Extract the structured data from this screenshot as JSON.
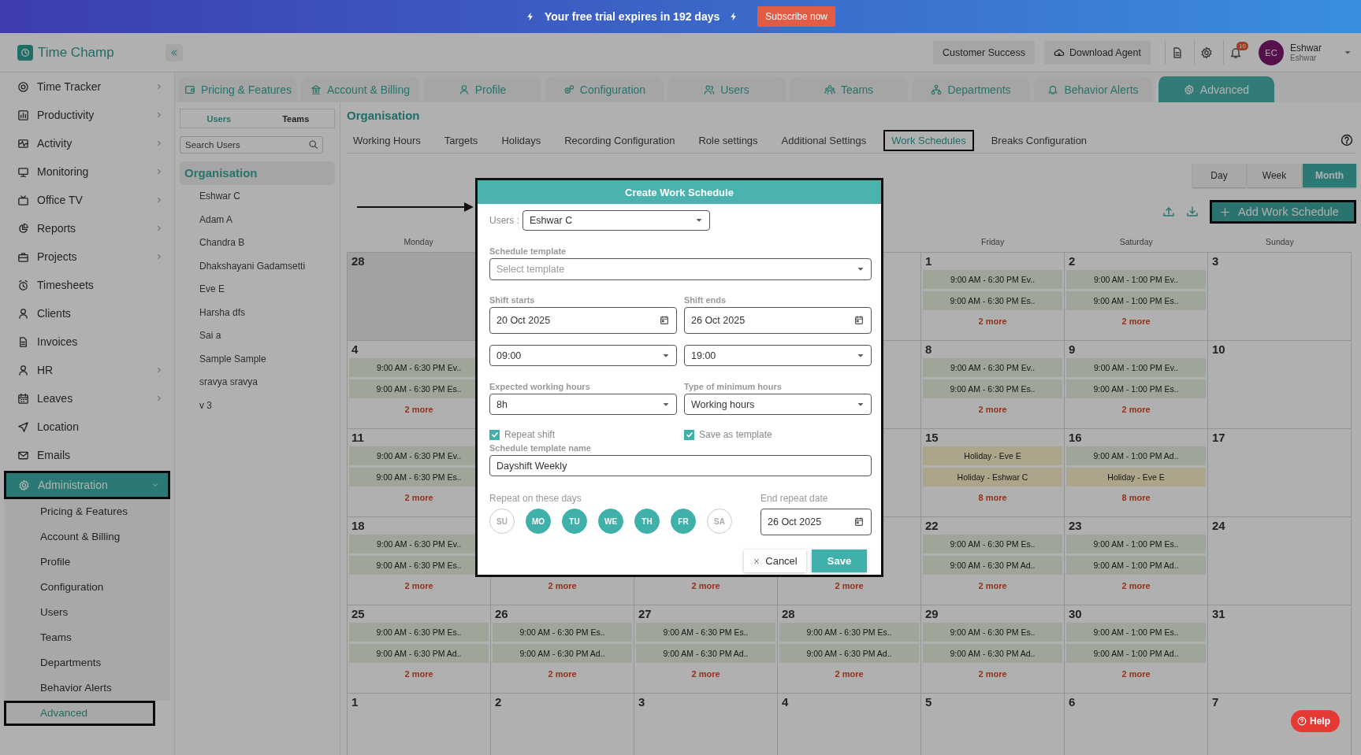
{
  "banner": {
    "message": "Your free trial expires in 192 days",
    "action": "Subscribe now"
  },
  "header": {
    "app_name": "Time Champ",
    "buttons": [
      "Customer Success",
      "Download Agent"
    ],
    "notification_count": "10",
    "user": {
      "initials": "EC",
      "name": "Eshwar",
      "subtitle": "Eshwar"
    }
  },
  "sidebar": {
    "items": [
      {
        "label": "Time Tracker",
        "has_submenu": true,
        "expanded": false,
        "selected": false
      },
      {
        "label": "Productivity",
        "has_submenu": true,
        "expanded": false,
        "selected": false
      },
      {
        "label": "Activity",
        "has_submenu": true,
        "expanded": false,
        "selected": false
      },
      {
        "label": "Monitoring",
        "has_submenu": true,
        "expanded": false,
        "selected": false
      },
      {
        "label": "Office TV",
        "has_submenu": true,
        "expanded": false,
        "selected": false
      },
      {
        "label": "Reports",
        "has_submenu": true,
        "expanded": false,
        "selected": false
      },
      {
        "label": "Projects",
        "has_submenu": true,
        "expanded": false,
        "selected": false
      },
      {
        "label": "Timesheets",
        "has_submenu": false,
        "selected": false
      },
      {
        "label": "Clients",
        "has_submenu": false,
        "selected": false
      },
      {
        "label": "Invoices",
        "has_submenu": false,
        "selected": false
      },
      {
        "label": "HR",
        "has_submenu": true,
        "expanded": false,
        "selected": false
      },
      {
        "label": "Leaves",
        "has_submenu": true,
        "expanded": false,
        "selected": false
      },
      {
        "label": "Location",
        "has_submenu": false,
        "selected": false
      },
      {
        "label": "Emails",
        "has_submenu": false,
        "selected": false
      },
      {
        "label": "Administration",
        "has_submenu": true,
        "expanded": true,
        "selected": true,
        "children": [
          {
            "label": "Pricing & Features",
            "selected": false
          },
          {
            "label": "Account & Billing",
            "selected": false
          },
          {
            "label": "Profile",
            "selected": false
          },
          {
            "label": "Configuration",
            "selected": false
          },
          {
            "label": "Users",
            "selected": false
          },
          {
            "label": "Teams",
            "selected": false
          },
          {
            "label": "Departments",
            "selected": false
          },
          {
            "label": "Behavior Alerts",
            "selected": false
          },
          {
            "label": "Advanced",
            "selected": true
          }
        ]
      }
    ]
  },
  "admin_tabs": [
    {
      "label": "Pricing & Features",
      "selected": false
    },
    {
      "label": "Account & Billing",
      "selected": false
    },
    {
      "label": "Profile",
      "selected": false
    },
    {
      "label": "Configuration",
      "selected": false
    },
    {
      "label": "Users",
      "selected": false
    },
    {
      "label": "Teams",
      "selected": false
    },
    {
      "label": "Departments",
      "selected": false
    },
    {
      "label": "Behavior Alerts",
      "selected": false
    },
    {
      "label": "Advanced",
      "selected": true
    }
  ],
  "user_panel": {
    "toggle": [
      {
        "label": "Users",
        "selected": true
      },
      {
        "label": "Teams",
        "selected": false
      }
    ],
    "search": {
      "placeholder": "Search Users"
    },
    "group": "Organisation",
    "users": [
      "Eshwar C",
      "Adam A",
      "Chandra B",
      "Dhakshayani Gadamsetti",
      "Eve E",
      "Harsha dfs",
      "Sai a",
      "Sample Sample",
      "sravya sravya",
      "v 3"
    ]
  },
  "main": {
    "title": "Organisation",
    "subtabs": [
      {
        "label": "Working Hours",
        "selected": false
      },
      {
        "label": "Targets",
        "selected": false
      },
      {
        "label": "Holidays",
        "selected": false
      },
      {
        "label": "Recording Configuration",
        "selected": false
      },
      {
        "label": "Role settings",
        "selected": false
      },
      {
        "label": "Additional Settings",
        "selected": false
      },
      {
        "label": "Work Schedules",
        "selected": true
      },
      {
        "label": "Breaks Configuration",
        "selected": false
      }
    ],
    "views": [
      {
        "label": "Day",
        "selected": false
      },
      {
        "label": "Week",
        "selected": false
      },
      {
        "label": "Month",
        "selected": true
      }
    ],
    "add_button": "Add Work Schedule"
  },
  "calendar": {
    "weekdays": {
      "monday": "Monday",
      "friday": "Friday",
      "saturday": "Saturday",
      "sunday": "Sunday"
    },
    "weeks": [
      {
        "cells": [
          {
            "day": "28",
            "shaded": true
          },
          {},
          {},
          {},
          {
            "day": "1",
            "shaded": false,
            "events": [
              {
                "text": "9:00 AM - 6:30 PM Ev..",
                "kind": "shift"
              },
              {
                "text": "9:00 AM - 6:30 PM Es..",
                "kind": "shift"
              }
            ],
            "more": "2 more"
          },
          {
            "day": "2",
            "shaded": false,
            "events": [
              {
                "text": "9:00 AM - 1:00 PM Ev..",
                "kind": "shift"
              },
              {
                "text": "9:00 AM - 1:00 PM Es..",
                "kind": "shift"
              }
            ],
            "more": "2 more"
          },
          {
            "day": "3",
            "shaded": false
          }
        ]
      },
      {
        "cells": [
          {
            "day": "4",
            "shaded": false,
            "events": [
              {
                "text": "9:00 AM - 6:30 PM Ev..",
                "kind": "shift"
              },
              {
                "text": "9:00 AM - 6:30 PM Es..",
                "kind": "shift"
              }
            ],
            "more": "2 more"
          },
          {},
          {},
          {},
          {
            "day": "8",
            "shaded": false,
            "events": [
              {
                "text": "9:00 AM - 6:30 PM Ev..",
                "kind": "shift"
              },
              {
                "text": "9:00 AM - 6:30 PM Es..",
                "kind": "shift"
              }
            ],
            "more": "2 more"
          },
          {
            "day": "9",
            "shaded": false,
            "events": [
              {
                "text": "9:00 AM - 1:00 PM Ev..",
                "kind": "shift"
              },
              {
                "text": "9:00 AM - 1:00 PM Es..",
                "kind": "shift"
              }
            ],
            "more": "2 more"
          },
          {
            "day": "10",
            "shaded": false
          }
        ]
      },
      {
        "cells": [
          {
            "day": "11",
            "shaded": false,
            "events": [
              {
                "text": "9:00 AM - 6:30 PM Ev..",
                "kind": "shift"
              },
              {
                "text": "9:00 AM - 6:30 PM Es..",
                "kind": "shift"
              }
            ],
            "more": "2 more"
          },
          {},
          {},
          {},
          {
            "day": "15",
            "shaded": false,
            "events": [
              {
                "text": "Holiday - Eve E",
                "kind": "holiday"
              },
              {
                "text": "Holiday - Eshwar C",
                "kind": "holiday"
              }
            ],
            "more": "8 more"
          },
          {
            "day": "16",
            "shaded": false,
            "events": [
              {
                "text": "9:00 AM - 1:00 PM Ad..",
                "kind": "shift"
              },
              {
                "text": "Holiday - Eve E",
                "kind": "holiday"
              }
            ],
            "more": "8 more"
          },
          {
            "day": "17",
            "shaded": false
          }
        ]
      },
      {
        "cells": [
          {
            "day": "18",
            "shaded": false,
            "events": [
              {
                "text": "9:00 AM - 6:30 PM Ev..",
                "kind": "shift"
              },
              {
                "text": "9:00 AM - 6:30 PM Es..",
                "kind": "shift"
              }
            ],
            "more": "2 more"
          },
          {
            "shaded": false,
            "more": "2 more"
          },
          {
            "shaded": false,
            "more": "2 more"
          },
          {
            "shaded": false,
            "more": "2 more"
          },
          {
            "day": "22",
            "shaded": false,
            "events": [
              {
                "text": "9:00 AM - 6:30 PM Es..",
                "kind": "shift"
              },
              {
                "text": "9:00 AM - 6:30 PM Ad..",
                "kind": "shift"
              }
            ],
            "more": "2 more"
          },
          {
            "day": "23",
            "shaded": false,
            "events": [
              {
                "text": "9:00 AM - 1:00 PM Es..",
                "kind": "shift"
              },
              {
                "text": "9:00 AM - 1:00 PM Ad..",
                "kind": "shift"
              }
            ],
            "more": "2 more"
          },
          {
            "day": "24",
            "shaded": false
          }
        ]
      },
      {
        "cells": [
          {
            "day": "25",
            "shaded": false,
            "events": [
              {
                "text": "9:00 AM - 6:30 PM Es..",
                "kind": "shift"
              },
              {
                "text": "9:00 AM - 6:30 PM Ad..",
                "kind": "shift"
              }
            ],
            "more": "2 more"
          },
          {
            "day": "26",
            "shaded": false,
            "events": [
              {
                "text": "9:00 AM - 6:30 PM Es..",
                "kind": "shift"
              },
              {
                "text": "9:00 AM - 6:30 PM Ad..",
                "kind": "shift"
              }
            ],
            "more": "2 more"
          },
          {
            "day": "27",
            "shaded": false,
            "events": [
              {
                "text": "9:00 AM - 6:30 PM Es..",
                "kind": "shift"
              },
              {
                "text": "9:00 AM - 6:30 PM Ad..",
                "kind": "shift"
              }
            ],
            "more": "2 more"
          },
          {
            "day": "28",
            "shaded": false,
            "events": [
              {
                "text": "9:00 AM - 6:30 PM Es..",
                "kind": "shift"
              },
              {
                "text": "9:00 AM - 6:30 PM Ad..",
                "kind": "shift"
              }
            ],
            "more": "2 more"
          },
          {
            "day": "29",
            "shaded": false,
            "events": [
              {
                "text": "9:00 AM - 6:30 PM Es..",
                "kind": "shift"
              },
              {
                "text": "9:00 AM - 6:30 PM Ad..",
                "kind": "shift"
              }
            ],
            "more": "2 more"
          },
          {
            "day": "30",
            "shaded": false,
            "events": [
              {
                "text": "9:00 AM - 1:00 PM Es..",
                "kind": "shift"
              },
              {
                "text": "9:00 AM - 1:00 PM Ad..",
                "kind": "shift"
              }
            ],
            "more": "2 more"
          },
          {
            "day": "31",
            "shaded": false
          }
        ]
      },
      {
        "cells": [
          {
            "day": "1",
            "shaded": false
          },
          {
            "day": "2",
            "shaded": false
          },
          {
            "day": "3",
            "shaded": false
          },
          {
            "day": "4",
            "shaded": false
          },
          {
            "day": "5",
            "shaded": false
          },
          {
            "day": "6",
            "shaded": false
          },
          {
            "day": "7",
            "shaded": false
          }
        ]
      }
    ]
  },
  "modal": {
    "title": "Create Work Schedule",
    "users_label": "Users :",
    "user_value": "Eshwar C",
    "template_label": "Schedule template",
    "template_placeholder": "Select template",
    "shift_starts_label": "Shift starts",
    "shift_start_date": "20 Oct 2025",
    "shift_ends_label": "Shift ends",
    "shift_end_date": "26 Oct 2025",
    "start_time": "09:00",
    "end_time": "19:00",
    "expected_label": "Expected working hours",
    "expected_value": "8h",
    "min_type_label": "Type of minimum hours",
    "min_type_value": "Working hours",
    "checkboxes": [
      {
        "label": "Repeat shift",
        "checked": true
      },
      {
        "label": "Save as template",
        "checked": true
      }
    ],
    "template_name_label": "Schedule template name",
    "template_name_value": "Dayshift Weekly",
    "repeat_days_label": "Repeat on these days",
    "days": [
      {
        "label": "SU",
        "selected": false
      },
      {
        "label": "MO",
        "selected": true
      },
      {
        "label": "TU",
        "selected": true
      },
      {
        "label": "WE",
        "selected": true
      },
      {
        "label": "TH",
        "selected": true
      },
      {
        "label": "FR",
        "selected": true
      },
      {
        "label": "SA",
        "selected": false
      }
    ],
    "end_repeat_label": "End repeat date",
    "end_repeat_date": "26 Oct 2025",
    "cancel": "Cancel",
    "save": "Save"
  },
  "help": {
    "label": "Help"
  }
}
